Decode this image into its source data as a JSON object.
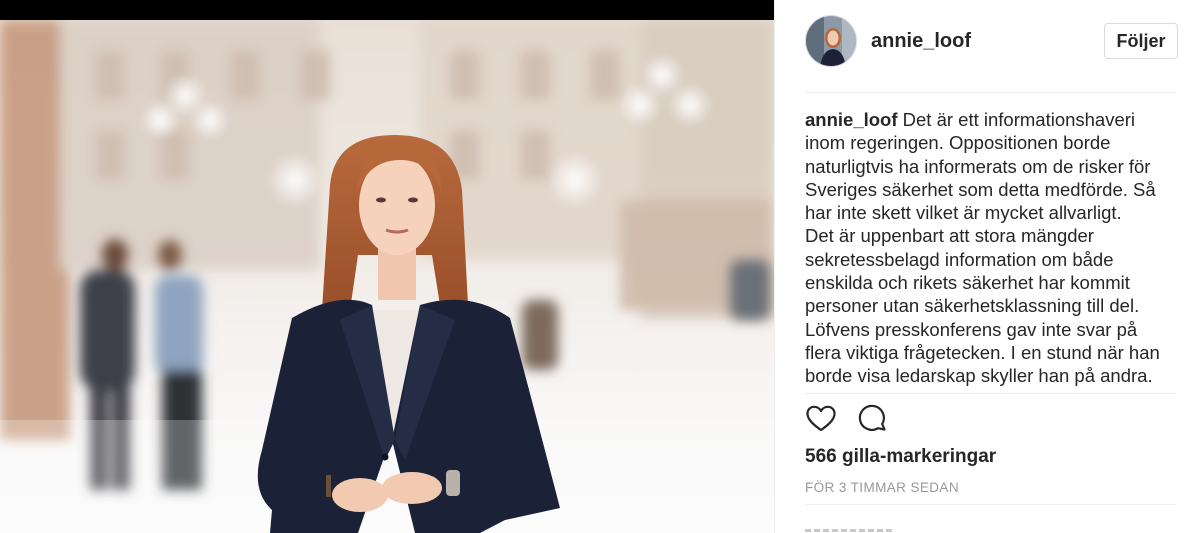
{
  "post": {
    "username": "annie_loof",
    "follow_label": "Följer",
    "caption_user": "annie_loof",
    "caption_lines": [
      " Det är ett informationshaveri",
      "inom regeringen. Oppositionen borde",
      "naturligtvis ha informerats om de risker för",
      "Sveriges säkerhet som detta medförde. Så",
      "har inte skett vilket är mycket allvarligt.",
      "Det är uppenbart att stora mängder",
      "sekretessbelagd information om både",
      "enskilda och rikets säkerhet har kommit",
      "personer utan säkerhetsklassning till del.",
      "Löfvens presskonferens gav inte svar på",
      "flera viktiga frågetecken. I en stund när han",
      "borde visa ledarskap skyller han på andra."
    ],
    "likes": "566 gilla-markeringar",
    "timestamp": "FÖR 3 TIMMAR SEDAN"
  },
  "icons": {
    "like": "heart-icon",
    "comment": "comment-icon"
  },
  "colors": {
    "text": "#262626",
    "muted": "#999999",
    "border": "#dbdbdb",
    "divider": "#efefef"
  }
}
